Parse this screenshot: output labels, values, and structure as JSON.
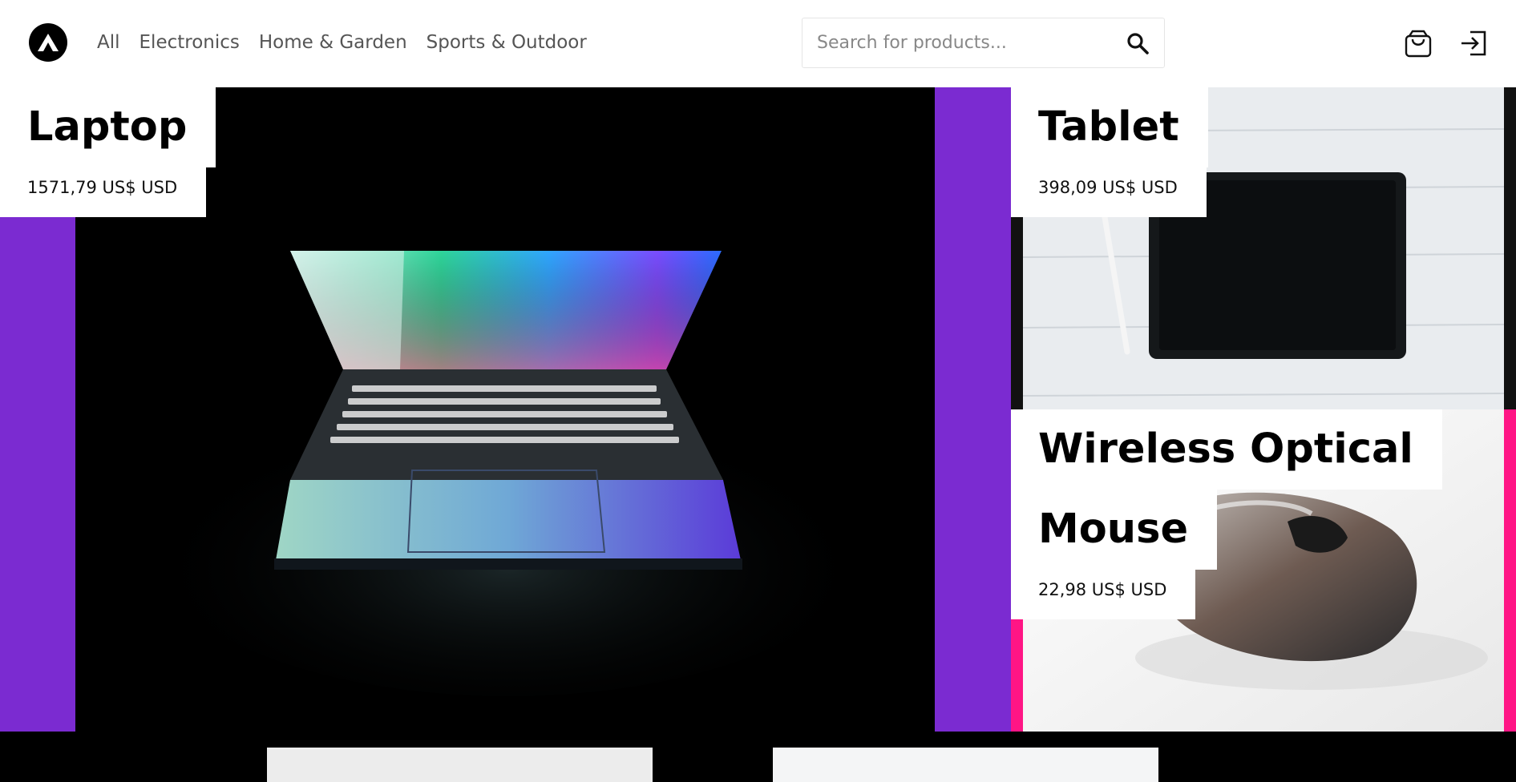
{
  "header": {
    "logo": "logo-icon",
    "nav": [
      "All",
      "Electronics",
      "Home & Garden",
      "Sports & Outdoor"
    ],
    "search": {
      "placeholder": "Search for products...",
      "value": ""
    },
    "icons": [
      "search-icon",
      "cart-icon",
      "login-icon"
    ]
  },
  "products": {
    "laptop": {
      "title": "Laptop",
      "price": "1571,79 US$ USD"
    },
    "tablet": {
      "title": "Tablet",
      "price": "398,09 US$ USD"
    },
    "mouse": {
      "title_line1": "Wireless Optical",
      "title_line2": "Mouse",
      "price": "22,98 US$ USD"
    }
  },
  "colors": {
    "purple": "#7b2bd1",
    "pink": "#ff1585",
    "black": "#000000"
  }
}
